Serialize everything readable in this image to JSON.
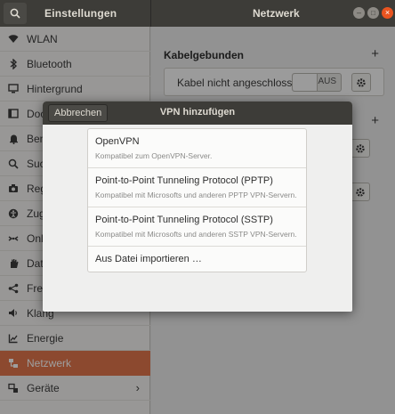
{
  "titlebar": {
    "left_title": "Einstellungen",
    "right_title": "Netzwerk",
    "search_icon": "search-icon",
    "buttons": [
      "minimize",
      "maximize",
      "close"
    ]
  },
  "sidebar": {
    "items": [
      {
        "label": "WLAN",
        "icon": "wifi-icon"
      },
      {
        "label": "Bluetooth",
        "icon": "bluetooth-icon"
      },
      {
        "label": "Hintergrund",
        "icon": "monitor-icon"
      },
      {
        "label": "Dock",
        "icon": "dock-icon"
      },
      {
        "label": "Benachrichtigungen",
        "icon": "bell-icon"
      },
      {
        "label": "Suche",
        "icon": "search-icon"
      },
      {
        "label": "Region & Sprache",
        "icon": "camera-icon"
      },
      {
        "label": "Zugangshilfen",
        "icon": "accessibility-icon"
      },
      {
        "label": "Online-Konten",
        "icon": "online-accounts-icon"
      },
      {
        "label": "Datenschutz",
        "icon": "hand-icon"
      },
      {
        "label": "Freigabe",
        "icon": "share-icon"
      },
      {
        "label": "Klang",
        "icon": "speaker-icon"
      },
      {
        "label": "Energie",
        "icon": "power-icon"
      },
      {
        "label": "Netzwerk",
        "icon": "network-icon"
      },
      {
        "label": "Geräte",
        "icon": "devices-icon"
      }
    ],
    "active": "Netzwerk",
    "chevron": "›"
  },
  "main": {
    "wired_title": "Kabelgebunden",
    "wired_status": "Kabel nicht angeschlossen",
    "wired_toggle": "AUS",
    "plus": "+"
  },
  "dialog": {
    "cancel_label": "Abbrechen",
    "title": "VPN hinzufügen",
    "options": [
      {
        "title": "OpenVPN",
        "desc": "Kompatibel zum OpenVPN-Server."
      },
      {
        "title": "Point-to-Point Tunneling Protocol (PPTP)",
        "desc": "Kompatibel mit Microsofts und anderen PPTP VPN-Servern."
      },
      {
        "title": "Point-to-Point Tunneling Protocol (SSTP)",
        "desc": "Kompatibel mit Microsofts und anderen SSTP VPN-Servern."
      },
      {
        "title": "Aus Datei importieren …",
        "desc": ""
      }
    ]
  },
  "colors": {
    "titlebar": "#3d3c38",
    "accent": "#e3774d",
    "close_button": "#e95420"
  }
}
